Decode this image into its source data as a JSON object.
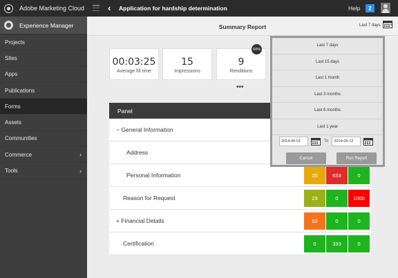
{
  "topbar": {
    "brand": "Adobe Marketing Cloud",
    "page_title": "Application for hardship determination",
    "help": "Help",
    "notifications": "2"
  },
  "sidebar": {
    "header": "Experience Manager",
    "items": [
      {
        "label": "Projects",
        "chevron": ""
      },
      {
        "label": "Sites",
        "chevron": ""
      },
      {
        "label": "Apps",
        "chevron": ""
      },
      {
        "label": "Publications",
        "chevron": ""
      },
      {
        "label": "Forms",
        "chevron": ""
      },
      {
        "label": "Assets",
        "chevron": ""
      },
      {
        "label": "Communities",
        "chevron": ""
      },
      {
        "label": "Commerce",
        "chevron": "›"
      },
      {
        "label": "Tools",
        "chevron": "›"
      }
    ],
    "active_index": 4
  },
  "report": {
    "title": "Summary Report",
    "range": "Last 7 days",
    "stats": [
      {
        "value": "00:03:25",
        "caption": "Average fill time"
      },
      {
        "value": "15",
        "caption": "Impressions"
      },
      {
        "value": "9",
        "caption": "Renditions"
      }
    ],
    "badge": "60%",
    "more": "•••"
  },
  "table": {
    "header": "Panel",
    "rows": [
      {
        "label": "− General Information",
        "cells": []
      },
      {
        "label": "Address",
        "cells": []
      },
      {
        "label": "Personal Information",
        "cells": [
          {
            "v": "26",
            "c": "#e8a90e"
          },
          {
            "v": "633",
            "c": "#e02b2b"
          },
          {
            "v": "0",
            "c": "#1fb31f"
          }
        ]
      },
      {
        "label": "Reason for Request",
        "cells": [
          {
            "v": "23",
            "c": "#9ab217"
          },
          {
            "v": "0",
            "c": "#1fb31f"
          },
          {
            "v": "1000",
            "c": "#ff0000"
          }
        ]
      },
      {
        "label": "+ Financial Details",
        "cells": [
          {
            "v": "63",
            "c": "#f5731c"
          },
          {
            "v": "0",
            "c": "#1fb31f"
          },
          {
            "v": "0",
            "c": "#1fb31f"
          }
        ]
      },
      {
        "label": "Certification",
        "cells": [
          {
            "v": "0",
            "c": "#1fb31f"
          },
          {
            "v": "333",
            "c": "#1fb31f"
          },
          {
            "v": "0",
            "c": "#1fb31f"
          }
        ]
      }
    ]
  },
  "popover": {
    "options": [
      "Last 7 days",
      "Last 15 days",
      "Last 1 month",
      "Last 3 months",
      "Last 6 months",
      "Last 1 year"
    ],
    "from_date": "2014-05-01",
    "to_label": "To",
    "to_date": "2014-05-12",
    "cancel": "Cancel",
    "run": "Run Report"
  },
  "colors": {
    "topbar": "#2b2b2b",
    "sidebar": "#3e3e3e",
    "accent": "#2a8ff0"
  }
}
